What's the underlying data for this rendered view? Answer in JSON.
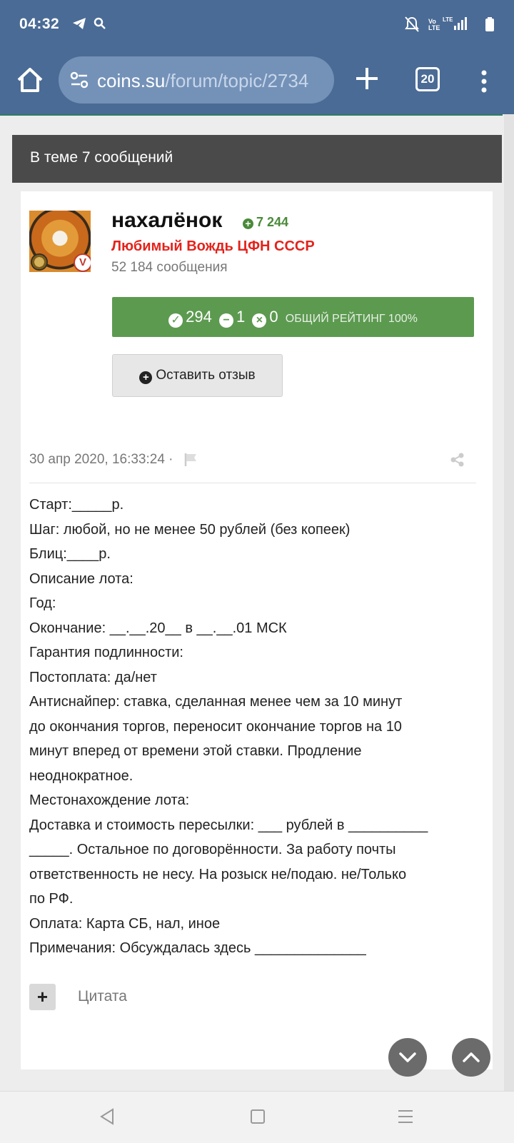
{
  "status_bar": {
    "time": "04:32",
    "network": "LTE"
  },
  "browser": {
    "url_host": "coins.su",
    "url_path": "/forum/topic/2734",
    "tab_count": "20"
  },
  "topic": {
    "header": "В теме 7 сообщений"
  },
  "post": {
    "username": "нахалёнок",
    "reputation": "7 244",
    "user_title": "Любимый Вождь ЦФН СССР",
    "message_count": "52 184 сообщения",
    "rating": {
      "positive": "294",
      "negative": "1",
      "neutral": "0",
      "label": "ОБЩИЙ РЕЙТИНГ 100%"
    },
    "review_button": "Оставить отзыв",
    "date": "30 апр 2020, 16:33:24 ·",
    "body_lines": [
      "Старт:_____р.",
      "Шаг: любой, но не менее 50 рублей (без копеек)",
      "Блиц:____р.",
      "Описание лота:",
      "Год:",
      "Окончание: __.__.20__ в __.__.01 МСК",
      "Гарантия подлинности:",
      "Постоплата: да/нет",
      "Антиснайпер: ставка, сделанная менее чем за 10 минут",
      "до окончания торгов, переносит окончание торгов на 10",
      "минут вперед от времени этой ставки. Продление",
      "неоднократное.",
      "Местонахождение лота:",
      "Доставка и стоимость пересылки: ___ рублей в __________",
      "_____. Остальное по договорённости. За работу почты",
      "ответственность не несу. На розыск не/подаю. не/Только",
      "по РФ.",
      "Оплата: Карта СБ, нал, иное",
      "Примечания: Обсуждалась здесь ______________"
    ],
    "quote_label": "Цитата"
  },
  "colors": {
    "browser_bar": "#4a6b95",
    "header_bg": "#4a4a4a",
    "rating_bg": "#5c9a50",
    "title_red": "#e3231c"
  }
}
